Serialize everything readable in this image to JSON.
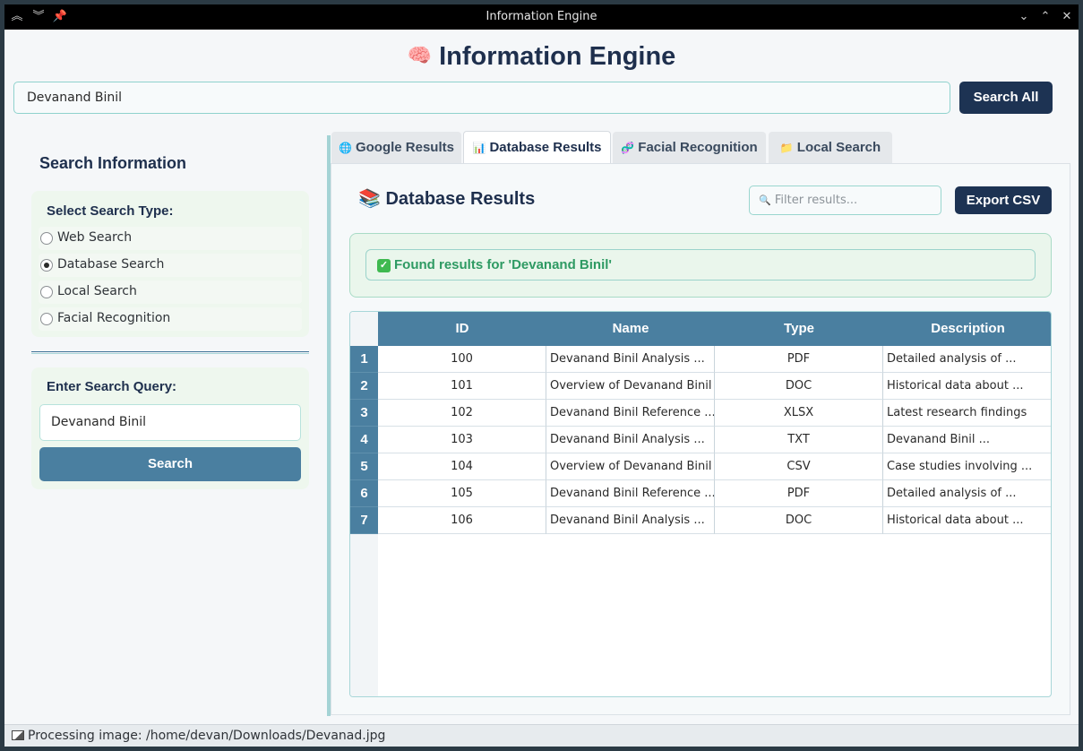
{
  "window": {
    "title": "Information Engine"
  },
  "header": {
    "emoji": "🧠",
    "title": "Information Engine"
  },
  "top_search": {
    "value": "Devanand Binil",
    "button_label": "Search All"
  },
  "sidebar": {
    "heading": "Search Information",
    "search_type_title": "Select Search Type:",
    "options": [
      {
        "label": "Web Search",
        "selected": false
      },
      {
        "label": "Database Search",
        "selected": true
      },
      {
        "label": "Local Search",
        "selected": false
      },
      {
        "label": "Facial Recognition",
        "selected": false
      }
    ],
    "query_title": "Enter Search Query:",
    "query_value": "Devanand Binil",
    "search_button": "Search"
  },
  "tabs": [
    {
      "icon": "🌐",
      "label": "Google Results",
      "active": false
    },
    {
      "icon": "📊",
      "label": "Database Results",
      "active": true
    },
    {
      "icon": "🧬",
      "label": "Facial Recognition",
      "active": false
    },
    {
      "icon": "📁",
      "label": "Local Search",
      "active": false
    }
  ],
  "results": {
    "heading_icon": "📚",
    "heading": "Database Results",
    "filter_placeholder": "Filter results...",
    "export_label": "Export CSV",
    "found_message": "Found results for 'Devanand Binil'",
    "columns": [
      "ID",
      "Name",
      "Type",
      "Description"
    ],
    "rows": [
      {
        "num": "1",
        "id": "100",
        "name": "Devanand Binil Analysis ...",
        "type": "PDF",
        "desc": "Detailed analysis of ..."
      },
      {
        "num": "2",
        "id": "101",
        "name": "Overview of Devanand Binil",
        "type": "DOC",
        "desc": "Historical data about ..."
      },
      {
        "num": "3",
        "id": "102",
        "name": "Devanand Binil Reference ...",
        "type": "XLSX",
        "desc": "Latest research findings"
      },
      {
        "num": "4",
        "id": "103",
        "name": "Devanand Binil Analysis ...",
        "type": "TXT",
        "desc": "Devanand Binil ..."
      },
      {
        "num": "5",
        "id": "104",
        "name": "Overview of Devanand Binil",
        "type": "CSV",
        "desc": "Case studies involving ..."
      },
      {
        "num": "6",
        "id": "105",
        "name": "Devanand Binil Reference ...",
        "type": "PDF",
        "desc": "Detailed analysis of ..."
      },
      {
        "num": "7",
        "id": "106",
        "name": "Devanand Binil Analysis ...",
        "type": "DOC",
        "desc": "Historical data about ..."
      }
    ]
  },
  "status": {
    "text": "Processing image: /home/devan/Downloads/Devanad.jpg"
  }
}
